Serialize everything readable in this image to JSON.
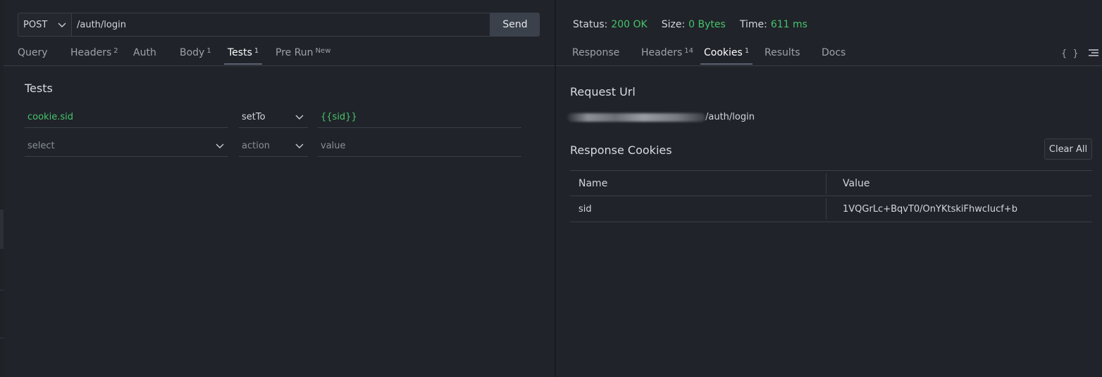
{
  "request": {
    "method": "POST",
    "url": "/auth/login",
    "send_label": "Send"
  },
  "request_tabs": [
    {
      "label": "Query",
      "badge": ""
    },
    {
      "label": "Headers",
      "badge": "2"
    },
    {
      "label": "Auth",
      "badge": ""
    },
    {
      "label": "Body",
      "badge": "1"
    },
    {
      "label": "Tests",
      "badge": "1",
      "active": true
    },
    {
      "label": "Pre Run",
      "badge": "New"
    }
  ],
  "tests": {
    "title": "Tests",
    "rows": [
      {
        "select": "cookie.sid",
        "action": "setTo",
        "value": "{{sid}}"
      },
      {
        "select_placeholder": "select",
        "action_placeholder": "action",
        "value_placeholder": "value"
      }
    ]
  },
  "response": {
    "status_label": "Status:",
    "status_value": "200 OK",
    "size_label": "Size:",
    "size_value": "0 Bytes",
    "time_label": "Time:",
    "time_value": "611 ms"
  },
  "response_tabs": [
    {
      "label": "Response",
      "badge": ""
    },
    {
      "label": "Headers",
      "badge": "14"
    },
    {
      "label": "Cookies",
      "badge": "1",
      "active": true
    },
    {
      "label": "Results",
      "badge": ""
    },
    {
      "label": "Docs",
      "badge": ""
    }
  ],
  "toolbar": {
    "braces_icon": "{ }",
    "menu_icon": "menu-lines-icon"
  },
  "cookies": {
    "request_url_title": "Request Url",
    "request_url_path": "/auth/login",
    "response_cookies_title": "Response Cookies",
    "clear_all_label": "Clear All",
    "columns": [
      "Name",
      "Value"
    ],
    "rows": [
      {
        "name": "sid",
        "value": "1VQGrLc+BqvT0/OnYKtskiFhwcIucf+b"
      }
    ]
  },
  "colors": {
    "background": "#202329",
    "accent_green": "#46c46c",
    "border": "#3a3e46"
  }
}
